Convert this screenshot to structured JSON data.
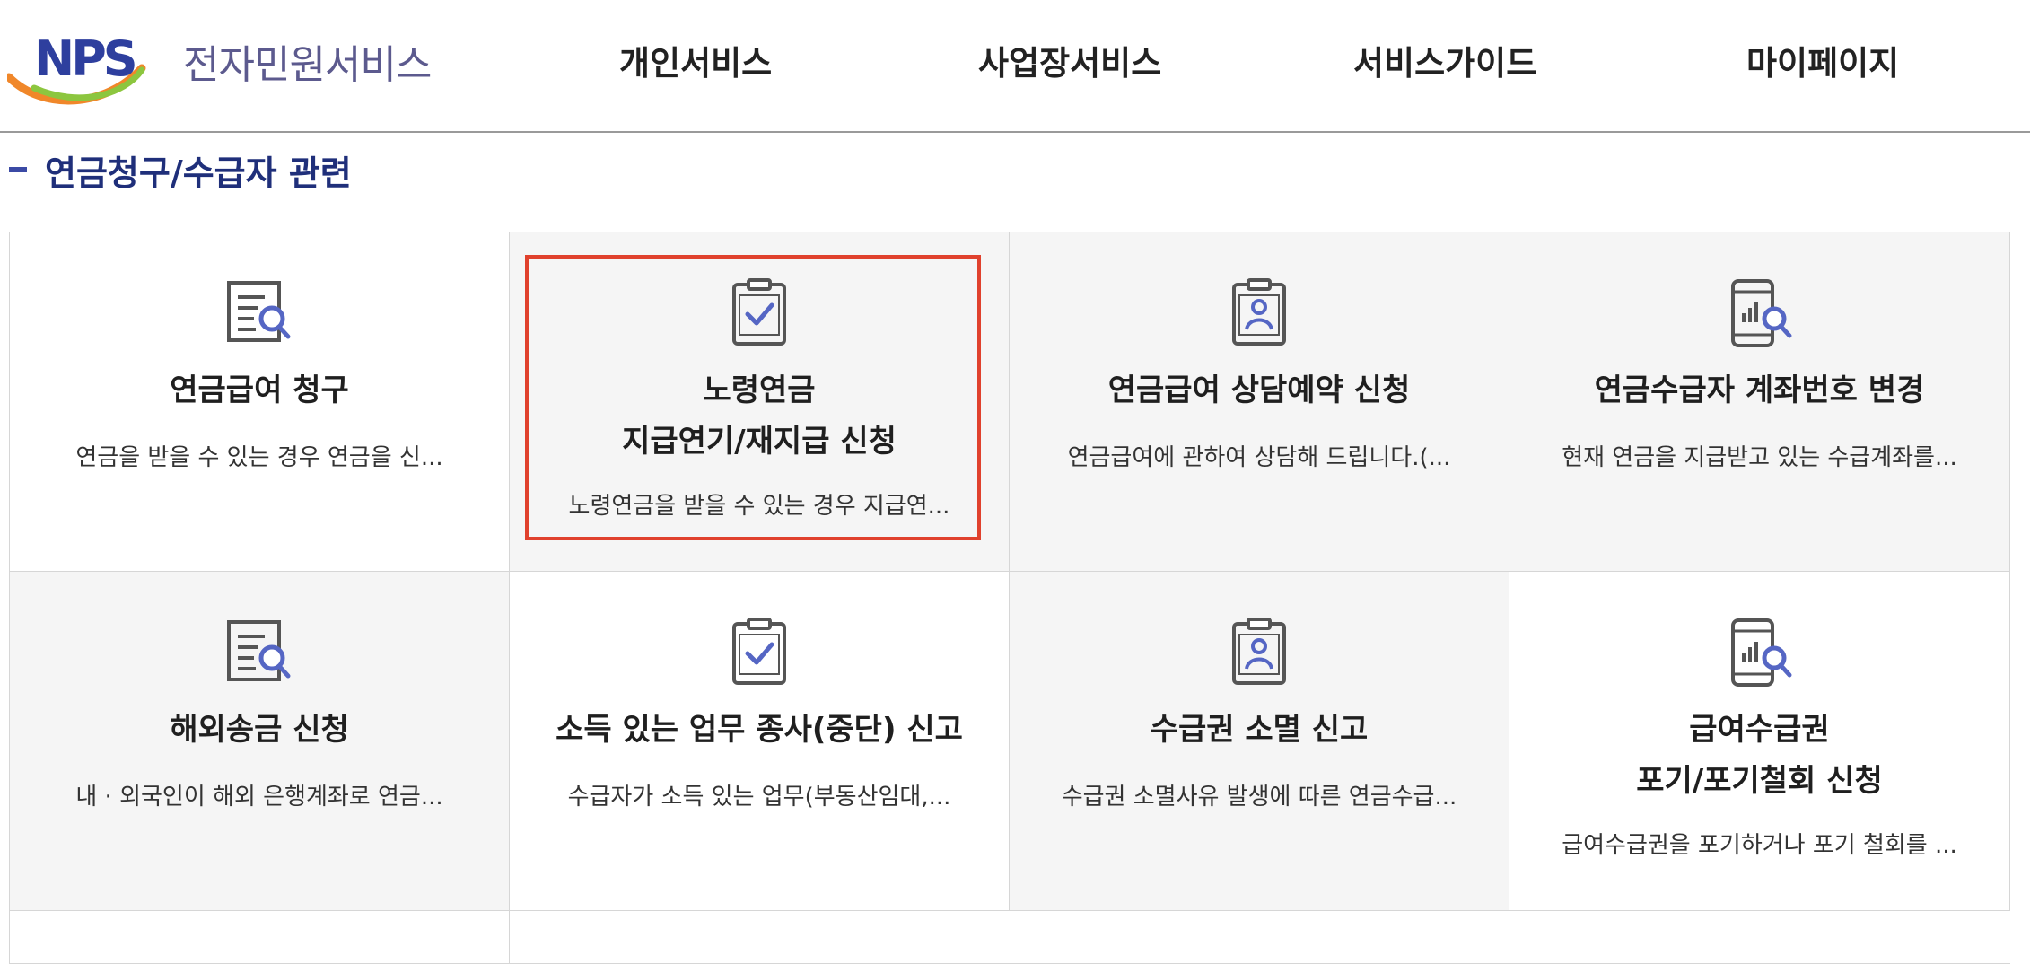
{
  "header": {
    "logo_letters": "NPS",
    "logo_text": "전자민원서비스",
    "nav": [
      "개인서비스",
      "사업장서비스",
      "서비스가이드",
      "마이페이지"
    ]
  },
  "section": {
    "title": "연금청구/수급자 관련"
  },
  "services": [
    {
      "title_lines": [
        "연금급여 청구"
      ],
      "desc": "연금을 받을 수 있는 경우 연금을 신...",
      "icon": "document-search-icon",
      "highlighted": false
    },
    {
      "title_lines": [
        "노령연금",
        "지급연기/재지급 신청"
      ],
      "desc": "노령연금을 받을 수 있는 경우 지급연...",
      "icon": "clipboard-check-icon",
      "highlighted": true
    },
    {
      "title_lines": [
        "연금급여 상담예약 신청"
      ],
      "desc": "연금급여에 관하여 상담해 드립니다.(...",
      "icon": "clipboard-person-icon",
      "highlighted": false
    },
    {
      "title_lines": [
        "연금수급자 계좌번호 변경"
      ],
      "desc": "현재 연금을 지급받고 있는 수급계좌를...",
      "icon": "mobile-chart-search-icon",
      "highlighted": false
    },
    {
      "title_lines": [
        "해외송금 신청"
      ],
      "desc": "내 · 외국인이 해외 은행계좌로 연금...",
      "icon": "document-search-icon",
      "highlighted": false
    },
    {
      "title_lines": [
        "소득 있는 업무 종사(중단) 신고"
      ],
      "desc": "수급자가 소득 있는 업무(부동산임대,...",
      "icon": "clipboard-check-icon",
      "highlighted": false
    },
    {
      "title_lines": [
        "수급권 소멸 신고"
      ],
      "desc": "수급권 소멸사유 발생에 따른 연금수급...",
      "icon": "clipboard-person-icon",
      "highlighted": false
    },
    {
      "title_lines": [
        "급여수급권",
        "포기/포기철회 신청"
      ],
      "desc": "급여수급권을 포기하거나 포기 철회를 ...",
      "icon": "mobile-chart-search-icon",
      "highlighted": false
    }
  ],
  "colors": {
    "accent": "#3b4aa5",
    "highlight": "#e0412d",
    "logo_blue": "#2e3f9e",
    "logo_orange": "#f0872a",
    "logo_green": "#8cc63f"
  }
}
